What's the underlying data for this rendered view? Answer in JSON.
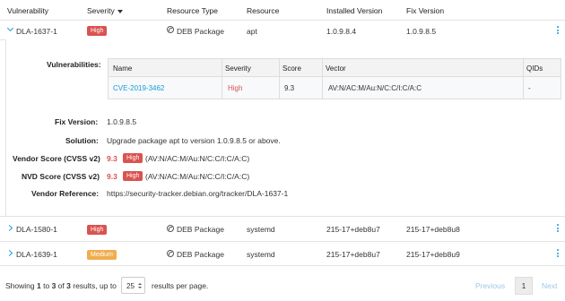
{
  "header": {
    "vulnerability": "Vulnerability",
    "severity": "Severity",
    "resource_type": "Resource Type",
    "resource": "Resource",
    "installed_version": "Installed Version",
    "fix_version": "Fix Version"
  },
  "rows": [
    {
      "id": "DLA-1637-1",
      "severity": "High",
      "resource_type": "DEB Package",
      "resource": "apt",
      "installed": "1.0.9.8.4",
      "fix": "1.0.9.8.5"
    },
    {
      "id": "DLA-1580-1",
      "severity": "High",
      "resource_type": "DEB Package",
      "resource": "systemd",
      "installed": "215-17+deb8u7",
      "fix": "215-17+deb8u8"
    },
    {
      "id": "DLA-1639-1",
      "severity": "Medium",
      "resource_type": "DEB Package",
      "resource": "systemd",
      "installed": "215-17+deb8u7",
      "fix": "215-17+deb8u9"
    }
  ],
  "detail": {
    "vulnerabilities_label": "Vulnerabilities:",
    "table_headers": {
      "name": "Name",
      "severity": "Severity",
      "score": "Score",
      "vector": "Vector",
      "qids": "QIDs"
    },
    "table_row": {
      "name": "CVE-2019-3462",
      "severity": "High",
      "score": "9.3",
      "vector": "AV:N/AC:M/Au:N/C:C/I:C/A:C",
      "qids": "-"
    },
    "fix_version_label": "Fix Version:",
    "fix_version": "1.0.9.8.5",
    "solution_label": "Solution:",
    "solution": "Upgrade package apt to version 1.0.9.8.5 or above.",
    "vendor_score_label": "Vendor Score (CVSS v2)",
    "vendor_score": "9.3",
    "vendor_score_badge": "High",
    "vendor_vector": "(AV:N/AC:M/Au:N/C:C/I:C/A:C)",
    "nvd_score_label": "NVD Score (CVSS v2)",
    "nvd_score": "9.3",
    "nvd_score_badge": "High",
    "nvd_vector": "(AV:N/AC:M/Au:N/C:C/I:C/A:C)",
    "vendor_ref_label": "Vendor Reference:",
    "vendor_ref": "https://security-tracker.debian.org/tracker/DLA-1637-1"
  },
  "footer": {
    "showing": "Showing",
    "from": "1",
    "to_word": "to",
    "to": "3",
    "of_word": "of",
    "total": "3",
    "results_upto": "results, up to",
    "per_page": "25",
    "results_per_page": "results per page.",
    "previous": "Previous",
    "current_page": "1",
    "next": "Next"
  },
  "colors": {
    "accent": "#1a9bd7",
    "high": "#d9534f",
    "medium": "#f0ad4e"
  }
}
